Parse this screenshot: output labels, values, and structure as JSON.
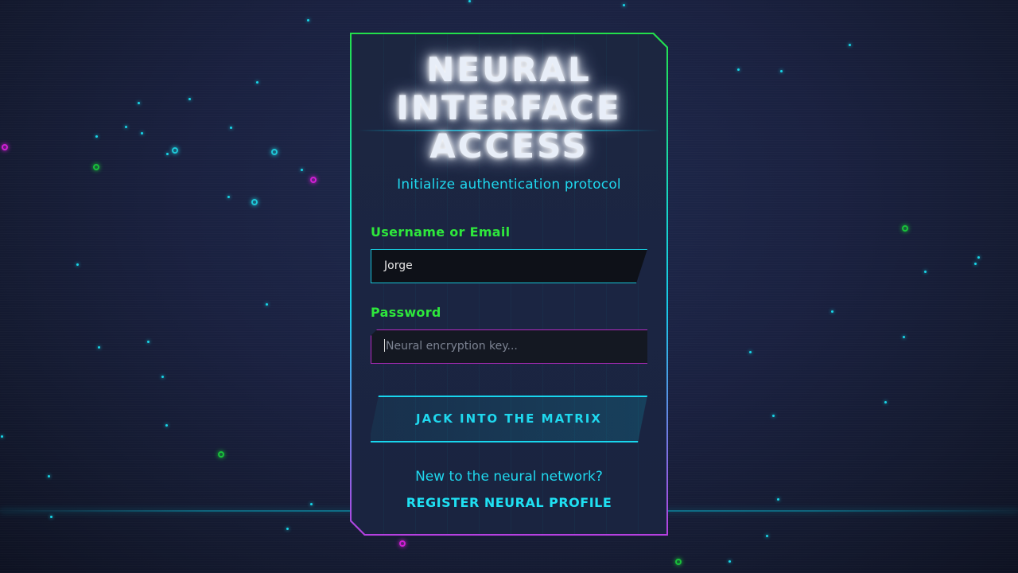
{
  "login": {
    "title_line1": "NEURAL",
    "title_line2": "INTERFACE",
    "title_line3": "ACCESS",
    "subtitle": "Initialize authentication protocol",
    "username_label": "Username or Email",
    "username_value": "Jorge",
    "password_label": "Password",
    "password_placeholder": "Neural encryption key...",
    "submit_label": "JACK INTO THE MATRIX",
    "signup_prompt": "New to the neural network?",
    "signup_link": "REGISTER NEURAL PROFILE"
  },
  "colors": {
    "accent_cyan": "#1fd8ee",
    "accent_green": "#2ee83c",
    "accent_magenta": "#b52ac0",
    "background": "#1a2140"
  }
}
